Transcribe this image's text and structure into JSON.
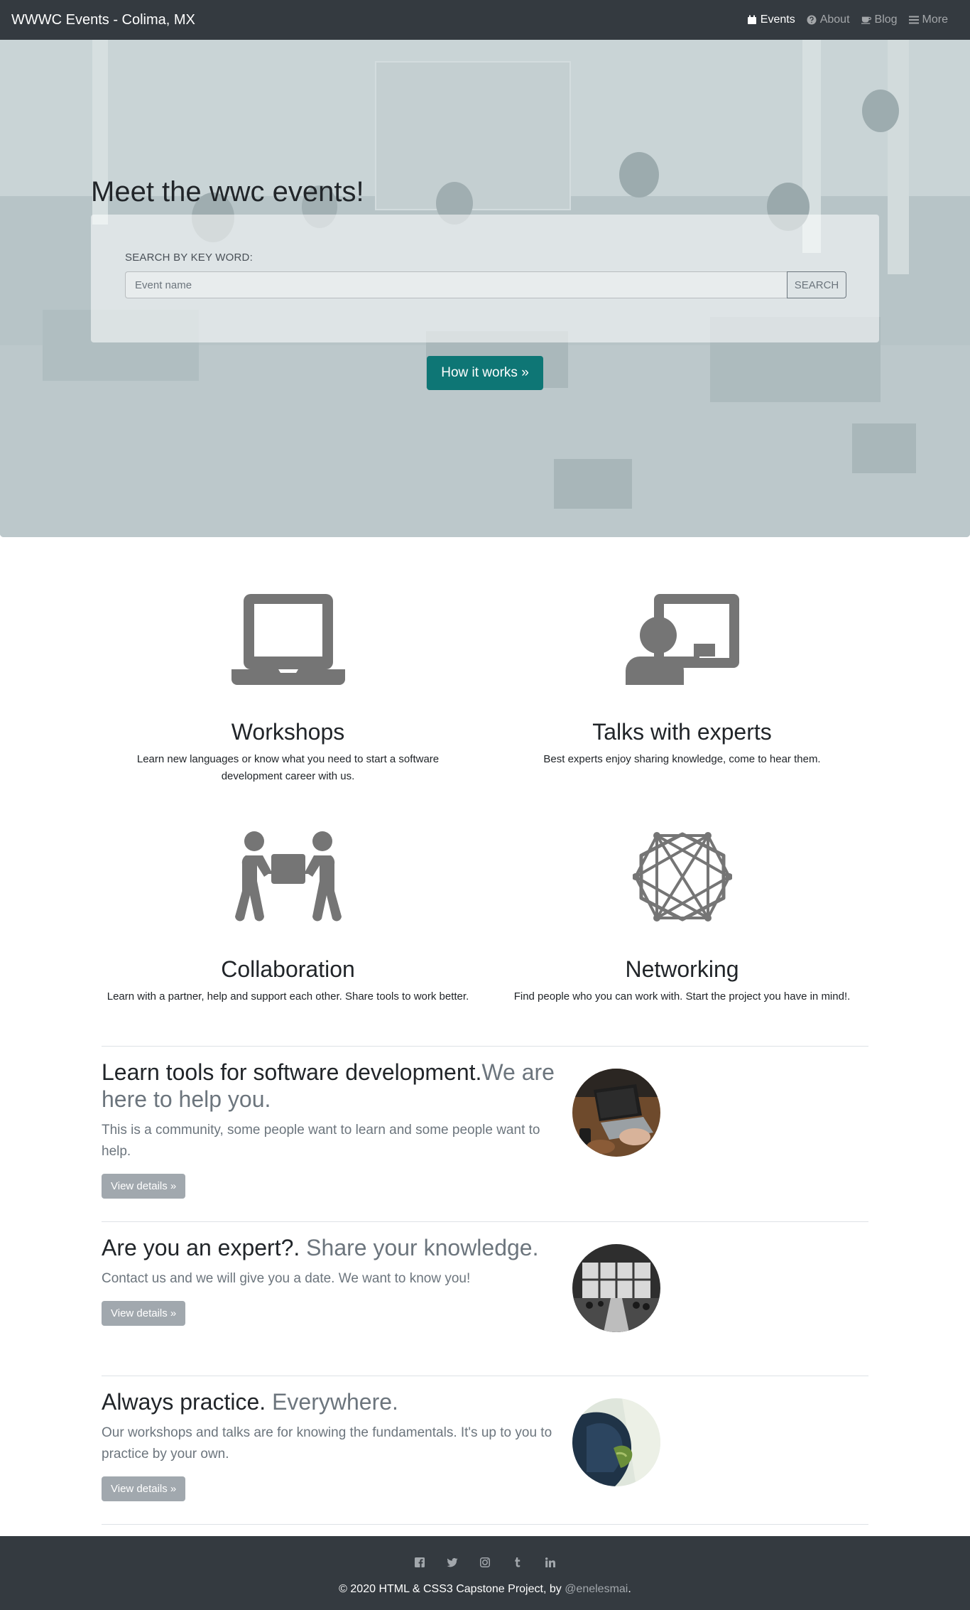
{
  "navbar": {
    "brand": "WWWC Events - Colima, MX",
    "links": [
      {
        "label": "Events",
        "icon": "calendar-icon",
        "active": true
      },
      {
        "label": "About",
        "icon": "question-circle-icon",
        "active": false
      },
      {
        "label": "Blog",
        "icon": "coffee-icon",
        "active": false
      },
      {
        "label": "More",
        "icon": "bars-icon",
        "active": false
      }
    ]
  },
  "hero": {
    "title": "Meet the wwc events!",
    "search_label": "SEARCH BY KEY WORD:",
    "search_placeholder": "Event name",
    "search_button": "SEARCH",
    "cta": "How it works »"
  },
  "features": [
    {
      "icon": "laptop-icon",
      "title": "Workshops",
      "text": "Learn new languages or know what you need to start a software development career with us."
    },
    {
      "icon": "chalkboard-teacher-icon",
      "title": "Talks with experts",
      "text": "Best experts enjoy sharing knowledge, come to hear them."
    },
    {
      "icon": "people-carry-icon",
      "title": "Collaboration",
      "text": "Learn with a partner, help and support each other. Share tools to work better."
    },
    {
      "icon": "network-hexagon-icon",
      "title": "Networking",
      "text": "Find people who you can work with. Start the project you have in mind!."
    }
  ],
  "promos": [
    {
      "heading": "Learn tools for software development.",
      "heading_muted": "We are here to help you.",
      "text": "This is a community, some people want to learn and some people want to help.",
      "button": "View details »",
      "image": "laptop-photo"
    },
    {
      "heading": "Are you an expert?. ",
      "heading_muted": "Share your knowledge.",
      "text": "Contact us and we will give you a date. We want to know you!",
      "button": "View details »",
      "image": "conference-room-photo"
    },
    {
      "heading": "Always practice. ",
      "heading_muted": "Everywhere.",
      "text": "Our workshops and talks are for knowing the fundamentals. It's up to you to practice by your own.",
      "button": "View details »",
      "image": "hooded-person-photo"
    }
  ],
  "footer": {
    "social_icons": [
      "facebook-icon",
      "twitter-icon",
      "instagram-icon",
      "tumblr-icon",
      "linkedin-icon"
    ],
    "copyright": "© 2020 HTML & CSS3 Capstone Project, by ",
    "handle": "@enelesmai",
    "period": "."
  },
  "colors": {
    "navbar": "#343a40",
    "accent": "#0e7675",
    "muted": "#6c757d",
    "icon": "#757575"
  }
}
